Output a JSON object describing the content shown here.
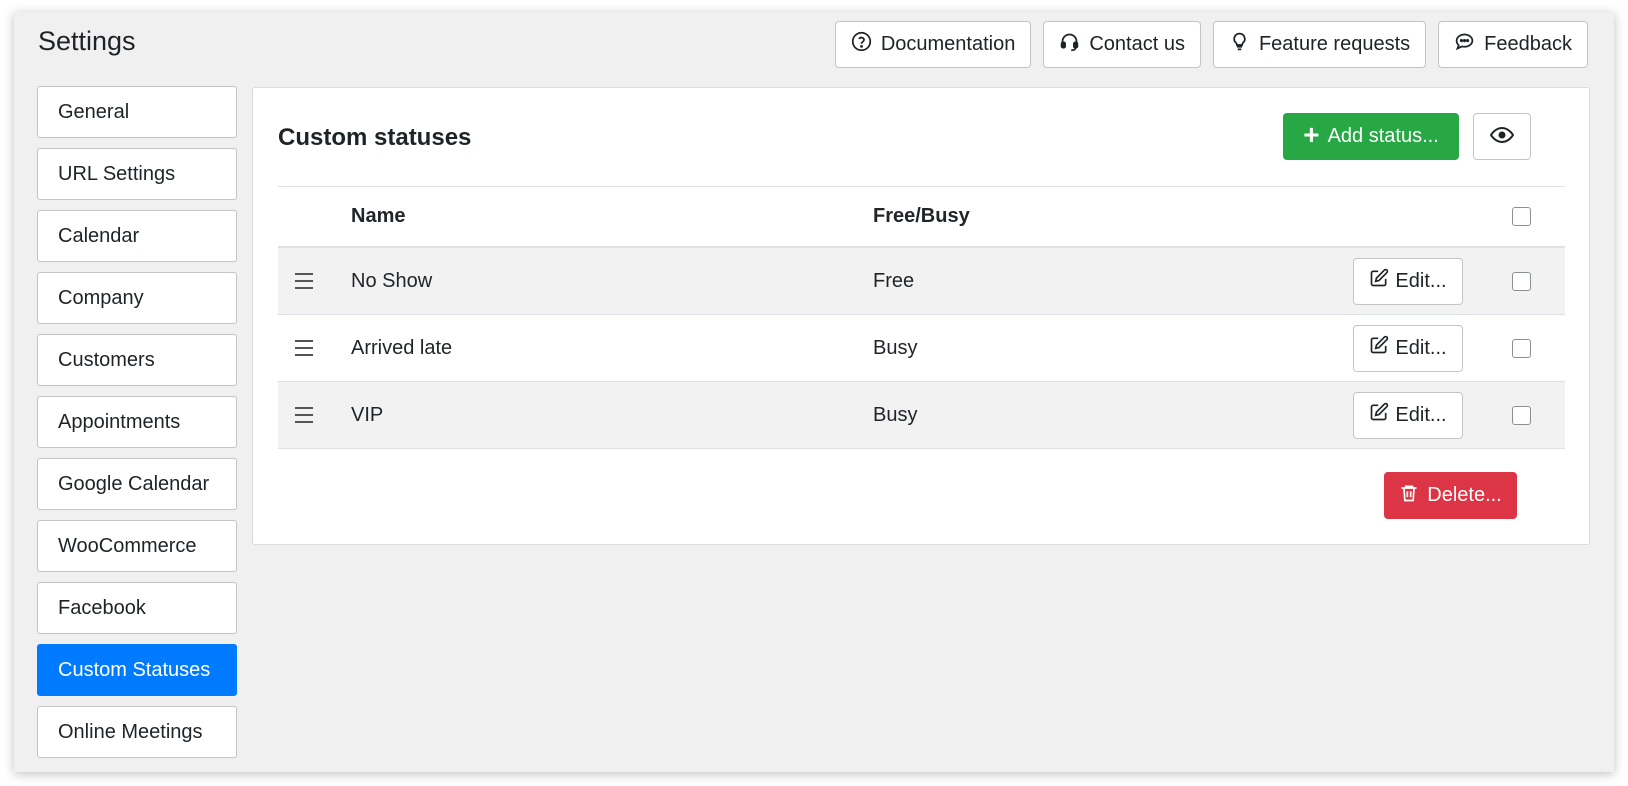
{
  "page": {
    "title": "Settings"
  },
  "top_actions": [
    {
      "label": "Documentation",
      "icon": "question-circle-icon"
    },
    {
      "label": "Contact us",
      "icon": "headset-icon"
    },
    {
      "label": "Feature requests",
      "icon": "lightbulb-icon"
    },
    {
      "label": "Feedback",
      "icon": "chat-bubble-icon"
    }
  ],
  "sidebar": {
    "items": [
      {
        "label": "General"
      },
      {
        "label": "URL Settings"
      },
      {
        "label": "Calendar"
      },
      {
        "label": "Company"
      },
      {
        "label": "Customers"
      },
      {
        "label": "Appointments"
      },
      {
        "label": "Google Calendar"
      },
      {
        "label": "WooCommerce"
      },
      {
        "label": "Facebook"
      },
      {
        "label": "Custom Statuses",
        "active": true
      },
      {
        "label": "Online Meetings"
      }
    ],
    "active_color": "#007bff"
  },
  "panel": {
    "title": "Custom statuses",
    "add_label": "Add status...",
    "delete_label": "Delete...",
    "add_color": "#28a745",
    "delete_color": "#dc3545"
  },
  "table": {
    "headers": {
      "name": "Name",
      "free_busy": "Free/Busy"
    },
    "edit_label": "Edit...",
    "rows": [
      {
        "name": "No Show",
        "free_busy": "Free"
      },
      {
        "name": "Arrived late",
        "free_busy": "Busy"
      },
      {
        "name": "VIP",
        "free_busy": "Busy"
      }
    ]
  }
}
